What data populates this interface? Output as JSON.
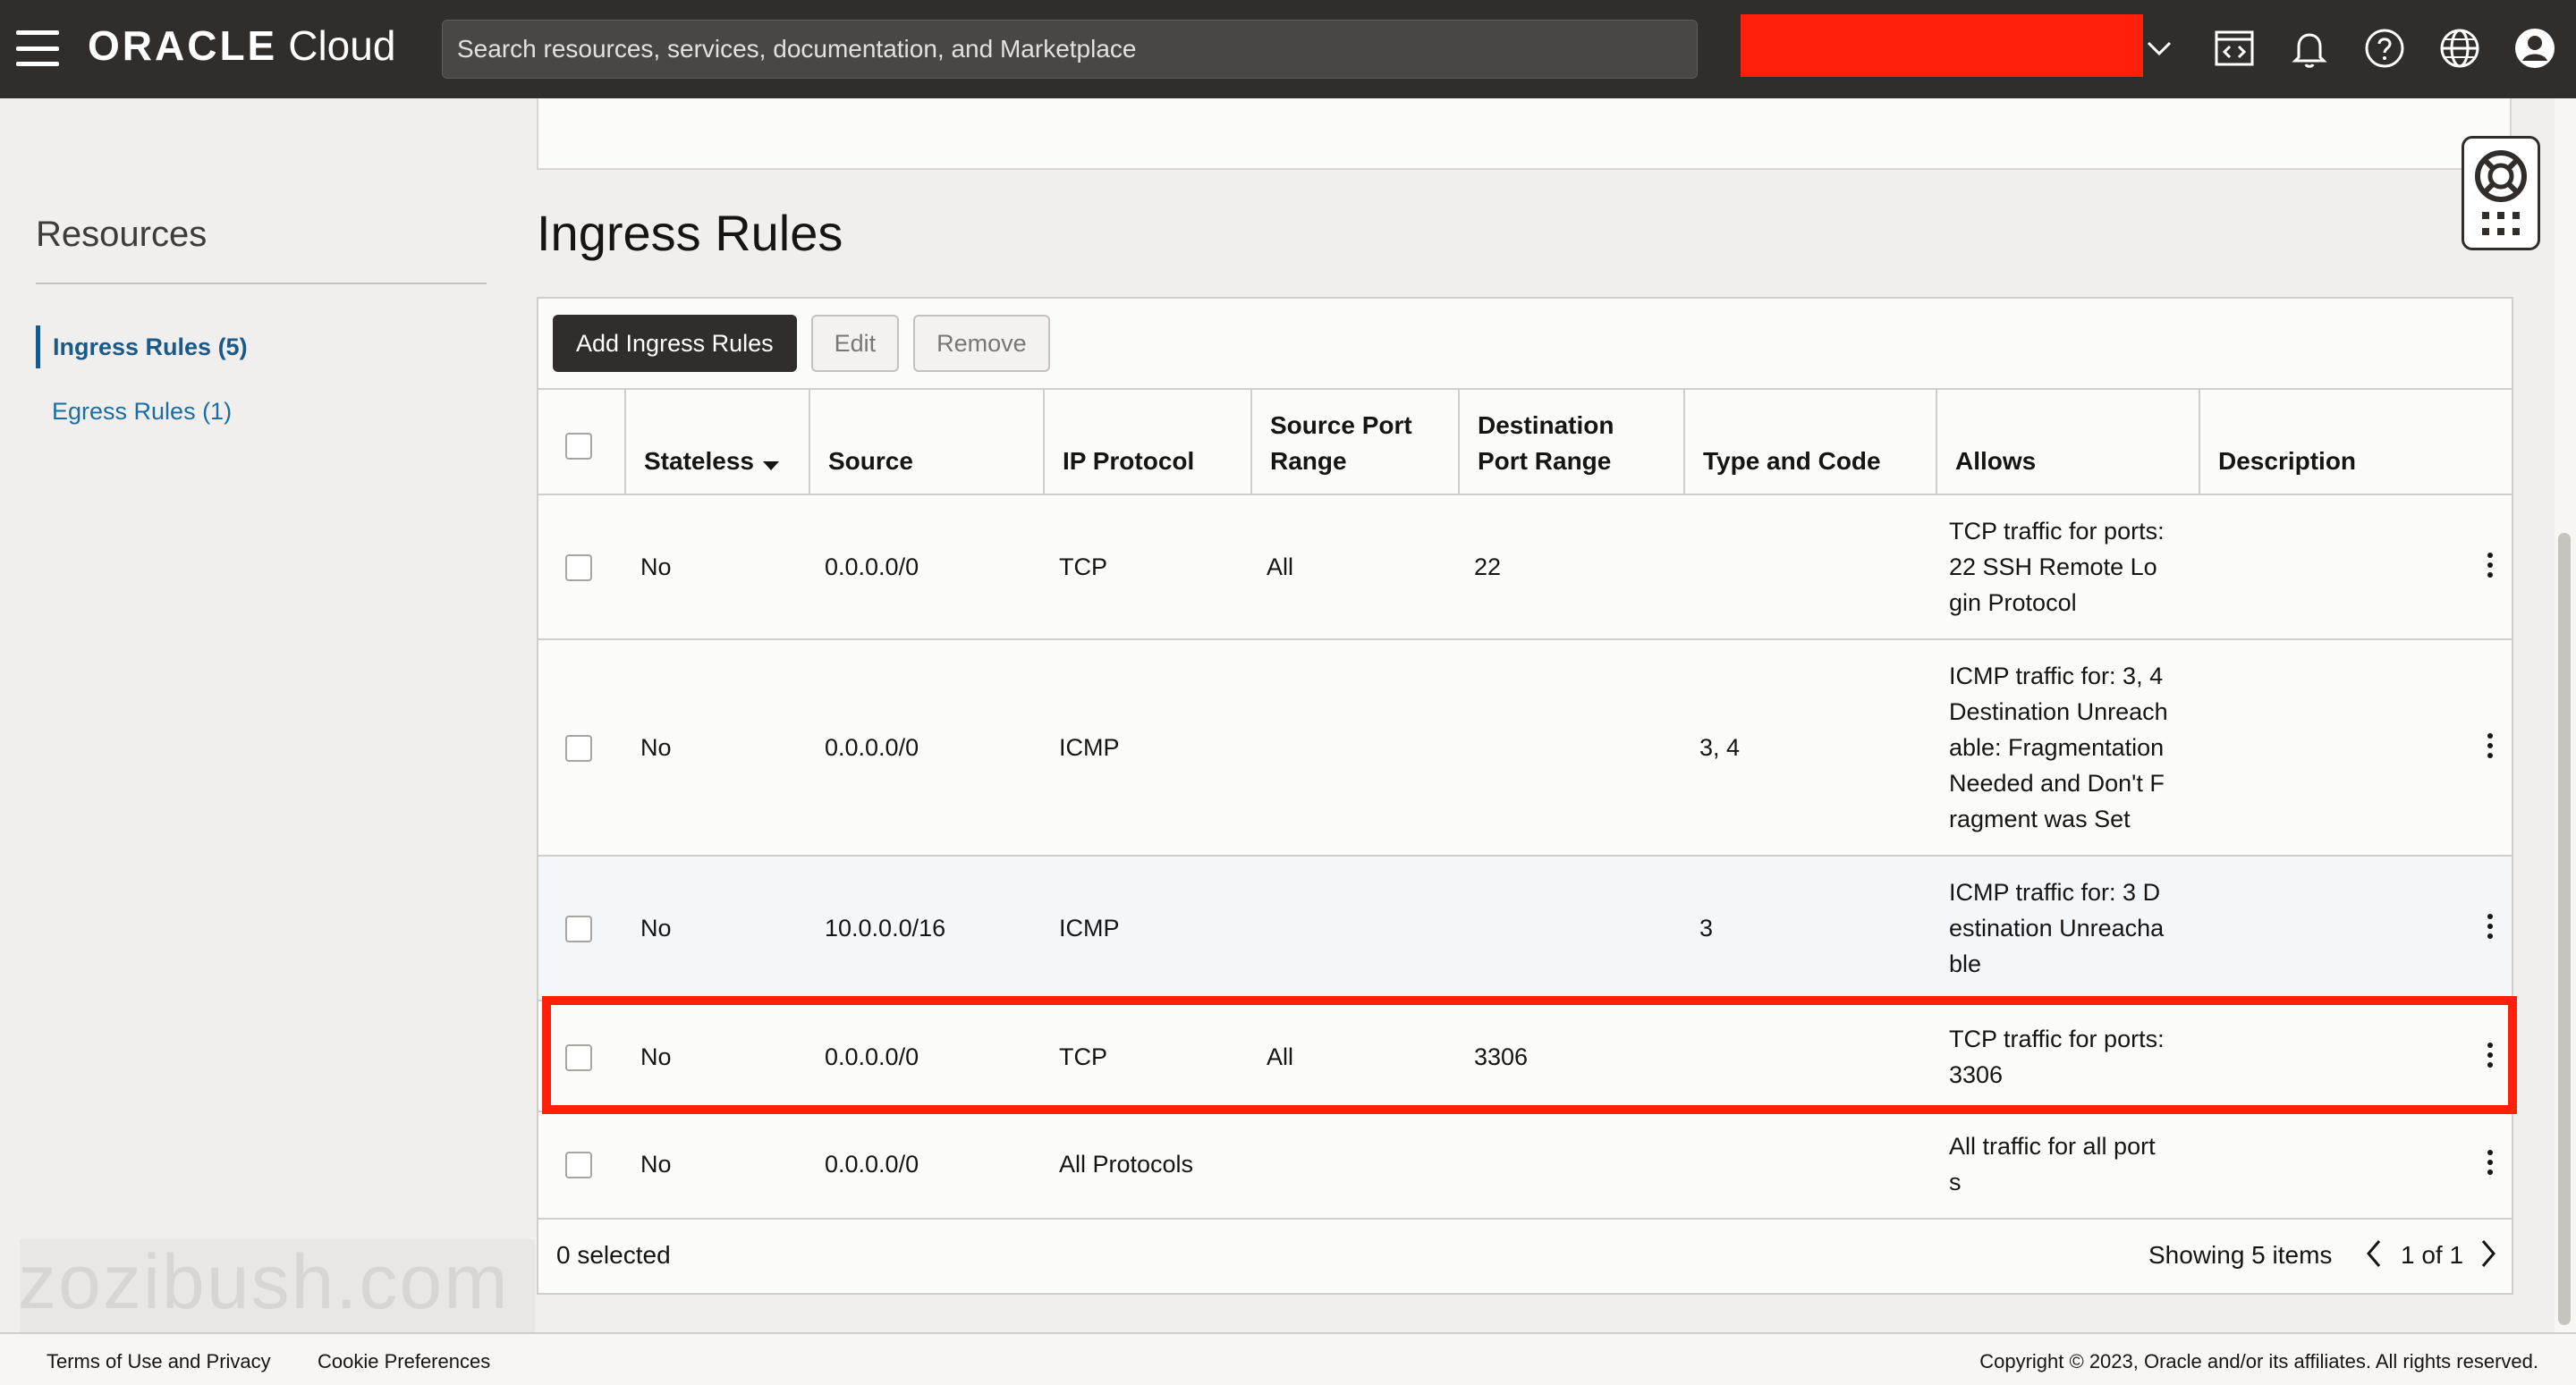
{
  "header": {
    "brand_oracle": "ORACLE",
    "brand_cloud": "Cloud",
    "search_placeholder": "Search resources, services, documentation, and Marketplace",
    "region_color": "#ff1f0a"
  },
  "icons": {
    "menu": "hamburger-menu-icon",
    "region_dropdown": "chevron-down-icon",
    "developer_tools": "code-console-icon",
    "notifications": "bell-icon",
    "help": "question-circle-icon",
    "language": "globe-icon",
    "profile": "user-avatar-icon",
    "support": "lifebuoy-icon",
    "apps": "grid-icon"
  },
  "sidebar": {
    "title": "Resources",
    "items": [
      {
        "label": "Ingress Rules (5)",
        "active": true
      },
      {
        "label": "Egress Rules (1)",
        "active": false
      }
    ]
  },
  "main": {
    "title": "Ingress Rules",
    "toolbar": {
      "add_label": "Add Ingress Rules",
      "edit_label": "Edit",
      "remove_label": "Remove"
    },
    "columns": [
      "Stateless",
      "Source",
      "IP Protocol",
      "Source Port Range",
      "Destination Port Range",
      "Type and Code",
      "Allows",
      "Description"
    ],
    "column_lines": {
      "source_port": [
        "Source Port",
        "Range"
      ],
      "dest_port": [
        "Destination",
        "Port Range"
      ]
    },
    "rows": [
      {
        "stateless": "No",
        "source": "0.0.0.0/0",
        "protocol": "TCP",
        "source_port": "All",
        "dest_port": "22",
        "type_code": "",
        "allows": "TCP traffic for ports:\n22 SSH Remote Lo\ngin Protocol",
        "description": ""
      },
      {
        "stateless": "No",
        "source": "0.0.0.0/0",
        "protocol": "ICMP",
        "source_port": "",
        "dest_port": "",
        "type_code": "3, 4",
        "allows": "ICMP traffic for: 3, 4\nDestination Unreach\nable: Fragmentation\nNeeded and Don't F\nragment was Set",
        "description": ""
      },
      {
        "stateless": "No",
        "source": "10.0.0.0/16",
        "protocol": "ICMP",
        "source_port": "",
        "dest_port": "",
        "type_code": "3",
        "allows": "ICMP traffic for: 3 D\nestination Unreacha\nble",
        "description": ""
      },
      {
        "stateless": "No",
        "source": "0.0.0.0/0",
        "protocol": "TCP",
        "source_port": "All",
        "dest_port": "3306",
        "type_code": "",
        "allows": "TCP traffic for ports:\n3306",
        "description": ""
      },
      {
        "stateless": "No",
        "source": "0.0.0.0/0",
        "protocol": "All Protocols",
        "source_port": "",
        "dest_port": "",
        "type_code": "",
        "allows": "All traffic for all port\ns",
        "description": ""
      }
    ],
    "footer": {
      "selected": "0 selected",
      "showing": "Showing 5 items",
      "page": "1 of 1"
    }
  },
  "page_footer": {
    "terms": "Terms of Use and Privacy",
    "cookies": "Cookie Preferences",
    "copyright": "Copyright © 2023, Oracle and/or its affiliates. All rights reserved."
  },
  "watermark": "zozibush.com"
}
